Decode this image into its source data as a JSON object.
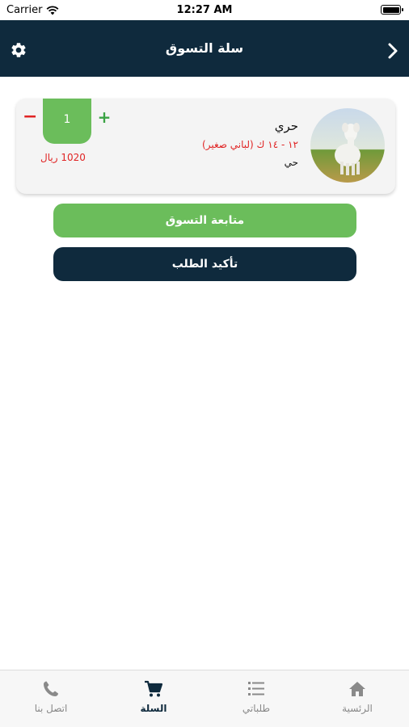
{
  "status_bar": {
    "carrier": "Carrier",
    "time": "12:27 AM"
  },
  "nav": {
    "title": "سلة التسوق"
  },
  "cart_item": {
    "name": "حري",
    "spec": "١٢ - ١٤ ك (لباني صغير)",
    "sub": "حي",
    "quantity": "1",
    "minus": "−",
    "plus": "+",
    "price": "1020 ريال"
  },
  "buttons": {
    "continue_shopping": "متابعة التسوق",
    "confirm_order": "تأكيد الطلب"
  },
  "tab_bar": {
    "home": "الرئسية",
    "orders": "طلباتي",
    "cart": "السلة",
    "contact": "اتصل بنا"
  },
  "colors": {
    "primary_dark": "#0f2a3d",
    "accent_green": "#6bbd5b",
    "alert_red": "#e02424"
  }
}
